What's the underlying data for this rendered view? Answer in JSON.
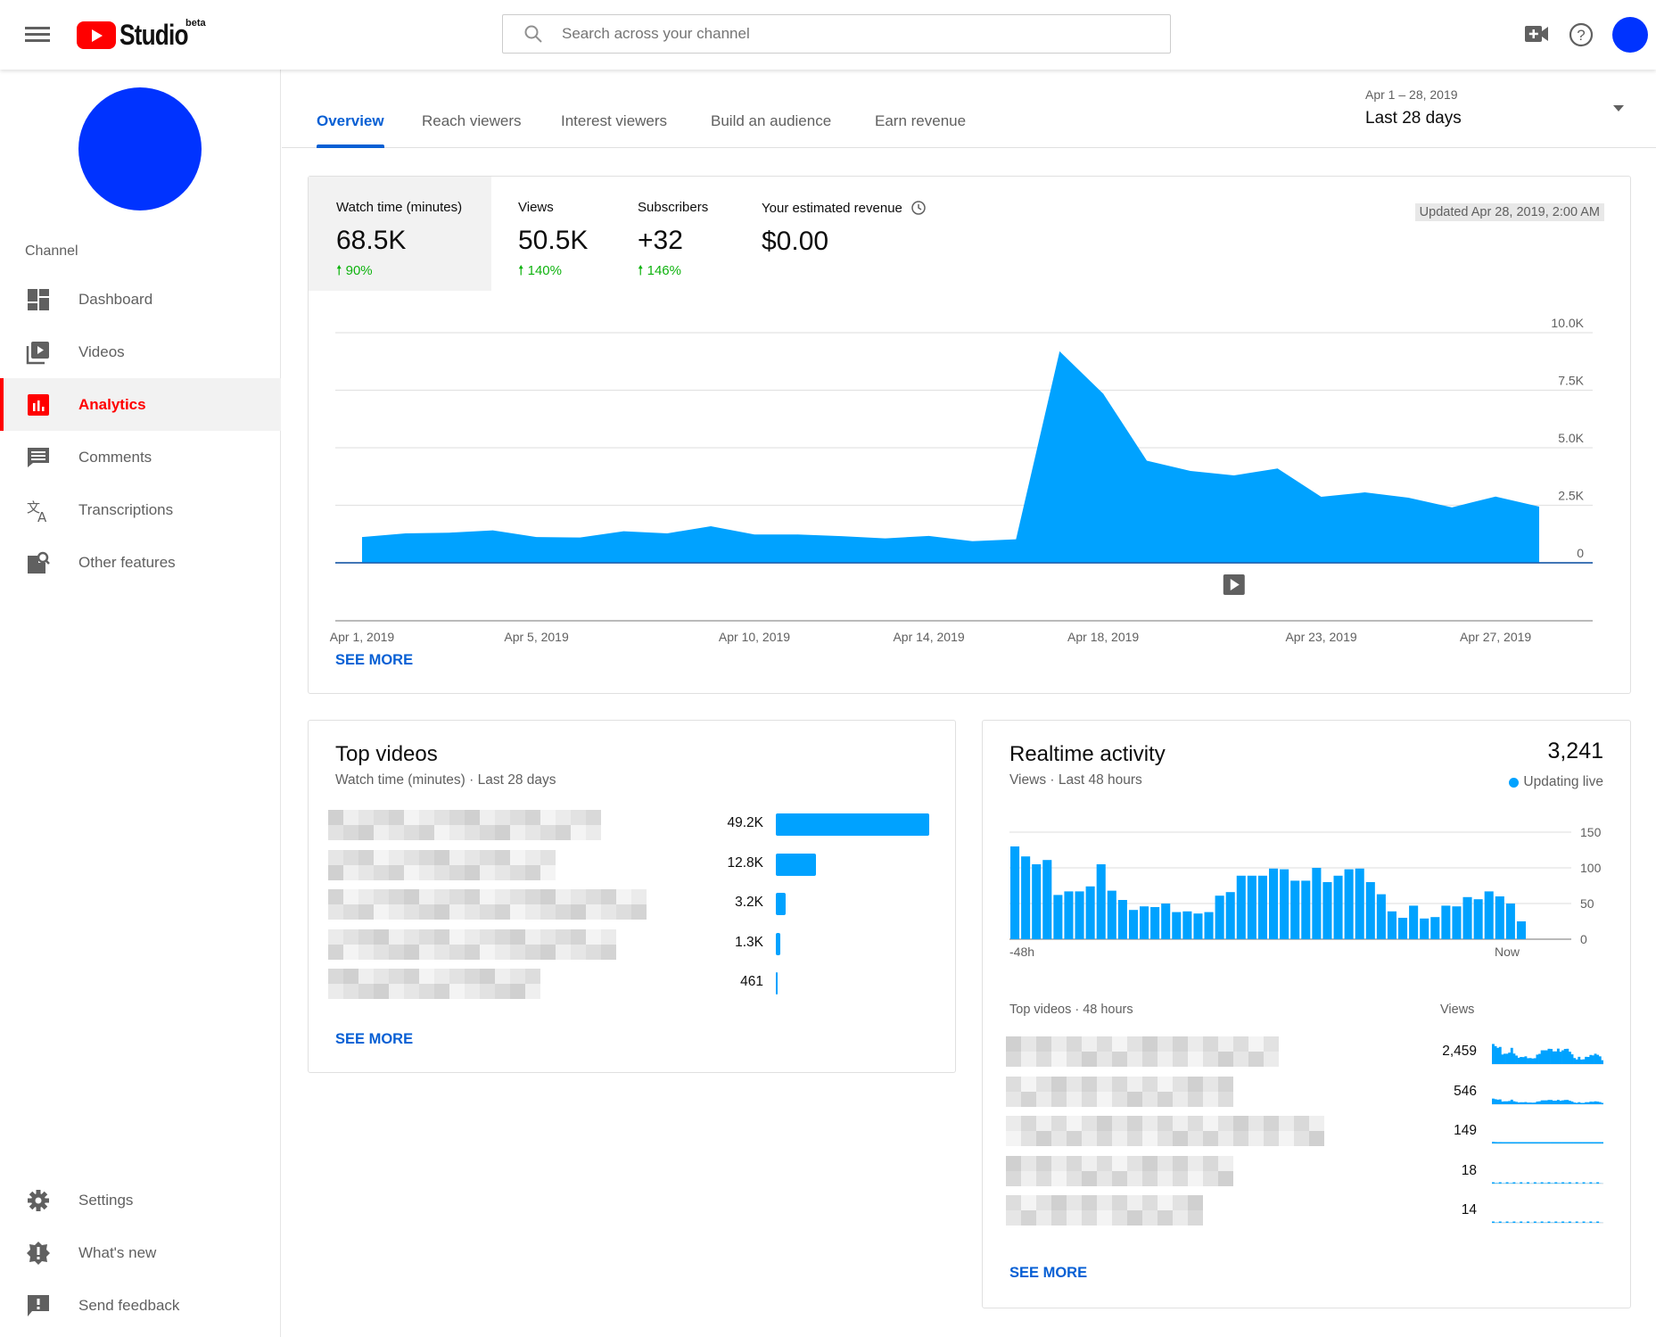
{
  "header": {
    "logo_text": "Studio",
    "logo_badge": "beta",
    "search_placeholder": "Search across your channel",
    "icons": [
      "menu-icon",
      "create-video-icon",
      "help-icon",
      "account-avatar"
    ]
  },
  "sidebar": {
    "section_label": "Channel",
    "items": [
      {
        "label": "Dashboard",
        "icon": "dashboard-icon",
        "active": false
      },
      {
        "label": "Videos",
        "icon": "videos-icon",
        "active": false
      },
      {
        "label": "Analytics",
        "icon": "analytics-icon",
        "active": true
      },
      {
        "label": "Comments",
        "icon": "comments-icon",
        "active": false
      },
      {
        "label": "Transcriptions",
        "icon": "translate-icon",
        "active": false
      },
      {
        "label": "Other features",
        "icon": "other-features-icon",
        "active": false
      }
    ],
    "bottom_items": [
      {
        "label": "Settings",
        "icon": "gear-icon"
      },
      {
        "label": "What's new",
        "icon": "whats-new-icon"
      },
      {
        "label": "Send feedback",
        "icon": "feedback-icon"
      }
    ]
  },
  "tabs": [
    {
      "label": "Overview",
      "active": true
    },
    {
      "label": "Reach viewers",
      "active": false
    },
    {
      "label": "Interest viewers",
      "active": false
    },
    {
      "label": "Build an audience",
      "active": false
    },
    {
      "label": "Earn revenue",
      "active": false
    }
  ],
  "date_range": {
    "range": "Apr 1 – 28, 2019",
    "selected": "Last 28 days"
  },
  "overview": {
    "metrics": [
      {
        "label": "Watch time (minutes)",
        "value": "68.5K",
        "change": "90%",
        "active": true
      },
      {
        "label": "Views",
        "value": "50.5K",
        "change": "140%",
        "active": false
      },
      {
        "label": "Subscribers",
        "value": "+32",
        "change": "146%",
        "active": false
      },
      {
        "label": "Your estimated revenue",
        "value": "$0.00",
        "change": "",
        "active": false
      }
    ],
    "updated": "Updated Apr 28, 2019, 2:00 AM",
    "see_more": "SEE MORE"
  },
  "top_videos": {
    "title": "Top videos",
    "subtitle": "Watch time (minutes) · Last 28 days",
    "see_more": "SEE MORE"
  },
  "realtime": {
    "title": "Realtime activity",
    "subtitle": "Views · Last 48 hours",
    "count": "3,241",
    "live_label": "Updating live",
    "list_header_left": "Top videos · 48 hours",
    "list_header_right": "Views",
    "see_more": "SEE MORE",
    "top_video_views": [
      "2,459",
      "546",
      "149",
      "18",
      "14"
    ]
  },
  "colors": {
    "accent": "#065fd4",
    "chart_fill": "#00a2ff",
    "active_nav": "#ff0000",
    "positive_change": "#0fb30f"
  },
  "chart_data": [
    {
      "type": "area",
      "title": "Watch time (minutes)",
      "xlabel": "",
      "ylabel": "",
      "x": [
        "Apr 1",
        "Apr 2",
        "Apr 3",
        "Apr 4",
        "Apr 5",
        "Apr 6",
        "Apr 7",
        "Apr 8",
        "Apr 9",
        "Apr 10",
        "Apr 11",
        "Apr 12",
        "Apr 13",
        "Apr 14",
        "Apr 15",
        "Apr 16",
        "Apr 17",
        "Apr 18",
        "Apr 19",
        "Apr 20",
        "Apr 21",
        "Apr 22",
        "Apr 23",
        "Apr 24",
        "Apr 25",
        "Apr 26",
        "Apr 27",
        "Apr 28"
      ],
      "values": [
        1120,
        1280,
        1310,
        1410,
        1120,
        1100,
        1370,
        1280,
        1590,
        1230,
        1230,
        1160,
        1060,
        1170,
        940,
        1020,
        9190,
        7350,
        4440,
        3990,
        3800,
        4100,
        2870,
        3060,
        2830,
        2410,
        2880,
        2440
      ],
      "x_tick_labels": [
        "Apr 1, 2019",
        "Apr 5, 2019",
        "Apr 10, 2019",
        "Apr 14, 2019",
        "Apr 18, 2019",
        "Apr 23, 2019",
        "Apr 27, 2019"
      ],
      "x_tick_indices": [
        0,
        4,
        9,
        13,
        17,
        22,
        26
      ],
      "y_tick_labels": [
        "0",
        "2.5K",
        "5.0K",
        "7.5K",
        "10.0K"
      ],
      "y_ticks": [
        0,
        2500,
        5000,
        7500,
        10000
      ],
      "ylim": [
        0,
        10000
      ],
      "grid": true,
      "annotation_index": 20
    },
    {
      "type": "bar",
      "title": "Top videos — Watch time (minutes)",
      "orientation": "horizontal",
      "categories": [
        "Video 1",
        "Video 2",
        "Video 3",
        "Video 4",
        "Video 5"
      ],
      "values": [
        49200,
        12800,
        3200,
        1300,
        461
      ],
      "value_labels": [
        "49.2K",
        "12.8K",
        "3.2K",
        "1.3K",
        "461"
      ]
    },
    {
      "type": "bar",
      "title": "Realtime views — Last 48 hours",
      "values": [
        130,
        116,
        105,
        111,
        62,
        67,
        67,
        74,
        105,
        68,
        55,
        41,
        46,
        45,
        50,
        38,
        39,
        36,
        38,
        61,
        66,
        89,
        89,
        89,
        99,
        98,
        82,
        82,
        100,
        80,
        89,
        98,
        99,
        80,
        63,
        39,
        30,
        47,
        29,
        31,
        47,
        46,
        59,
        56,
        67,
        60,
        50,
        25
      ],
      "x_tick_labels": [
        "-48h",
        "Now"
      ],
      "y_tick_labels": [
        "0",
        "50",
        "100",
        "150"
      ],
      "y_ticks": [
        0,
        50,
        100,
        150
      ],
      "ylim": [
        0,
        150
      ],
      "grid": true
    }
  ]
}
